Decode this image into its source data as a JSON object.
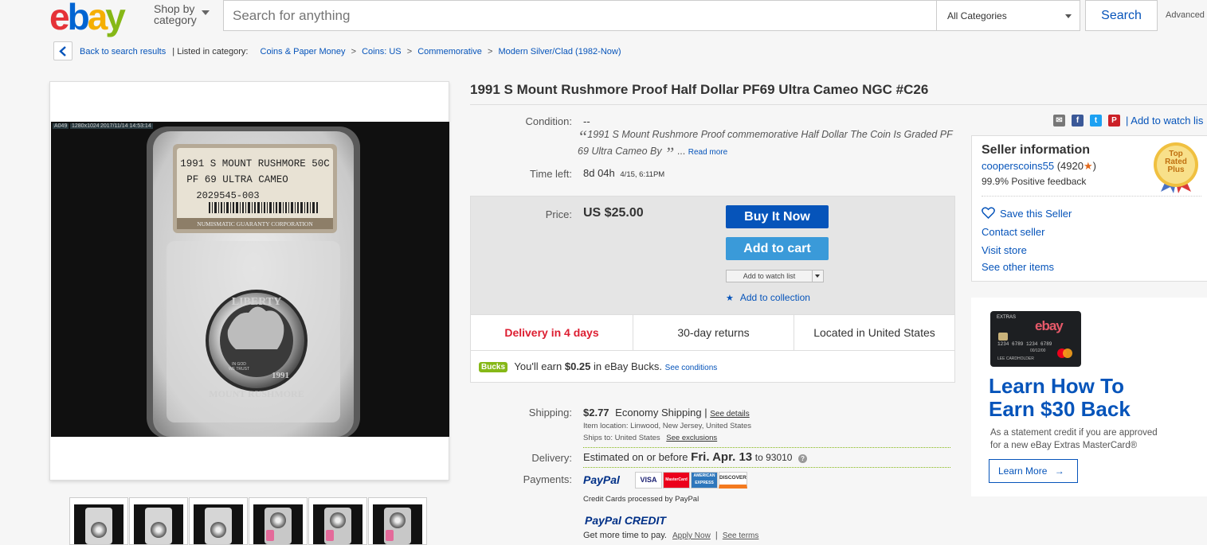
{
  "header": {
    "logo": [
      "e",
      "b",
      "a",
      "y"
    ],
    "shop_by": [
      "Shop by",
      "category"
    ],
    "search_placeholder": "Search for anything",
    "category_select": "All Categories",
    "search_button": "Search",
    "advanced": "Advanced"
  },
  "breadcrumb": {
    "back": "Back to search results",
    "listed_in": "| Listed in category:",
    "items": [
      "Coins & Paper Money",
      "Coins: US",
      "Commemorative",
      "Modern Silver/Clad (1982-Now)"
    ],
    "separator": ">"
  },
  "gallery": {
    "image_tags": [
      "A049",
      "1280x1024",
      "2017/11/14 14:53:14"
    ],
    "thumbnail_count": 6
  },
  "item": {
    "title": "1991 S Mount Rushmore Proof Half Dollar PF69 Ultra Cameo NGC #C26",
    "condition_label": "Condition:",
    "condition_value": "--",
    "condition_desc_open": "“",
    "condition_desc": "1991 S Mount Rushmore Proof commemorative Half Dollar The Coin Is Graded PF 69 Ultra Cameo By",
    "condition_desc_close": "”",
    "ellipsis": "...",
    "read_more": "Read more",
    "time_left_label": "Time left:",
    "time_left_value": "8d 04h",
    "time_left_end": "4/15, 6:11PM"
  },
  "purchase": {
    "price_label": "Price:",
    "price": "US $25.00",
    "buy_now": "Buy It Now",
    "add_to_cart": "Add to cart",
    "add_to_watch": "Add to watch list",
    "add_to_collection": "Add to collection",
    "collection_icon": "star-icon",
    "features": [
      "Delivery in 4 days",
      "30-day returns",
      "Located in United States"
    ],
    "bucks_badge": "Bucks",
    "bucks_text_pre": "You'll earn",
    "bucks_amount": "$0.25",
    "bucks_text_post": "in eBay Bucks.",
    "see_conditions": "See conditions"
  },
  "shipping": {
    "shipping_label": "Shipping:",
    "cost": "$2.77",
    "method": "Economy Shipping",
    "divider": "|",
    "see_details": "See details",
    "item_location": "Item location:  Linwood, New Jersey, United States",
    "ships_to": "Ships to:  United States",
    "see_exclusions": "See exclusions",
    "delivery_label": "Delivery:",
    "delivery_pre": "Estimated on or before",
    "delivery_date": "Fri. Apr. 13",
    "delivery_to": "to 93010",
    "payments_label": "Payments:",
    "paypal": "PayPal",
    "cards": [
      "VISA",
      "MasterCard",
      "AMERICAN EXPRESS",
      "DISCOVER"
    ],
    "cards_note": "Credit Cards processed by PayPal",
    "paypal_credit": "PayPal CREDIT",
    "credit_text": "Get more time to pay.",
    "apply_now": "Apply Now",
    "see_terms": "See terms"
  },
  "share": {
    "icons": [
      "email-icon",
      "facebook-icon",
      "twitter-icon",
      "pinterest-icon"
    ],
    "watch_list": "| Add to watch lis"
  },
  "seller": {
    "heading": "Seller information",
    "name": "cooperscoins55",
    "score": "(4920",
    "score_close": ")",
    "feedback": "99.9% Positive feedback",
    "badge_text": [
      "Top",
      "Rated",
      "Plus"
    ],
    "save": "Save this Seller",
    "contact": "Contact seller",
    "visit": "Visit store",
    "other": "See other items"
  },
  "ad": {
    "card_label": "EXTRAS",
    "card_brand": "ebay",
    "card_number": "1234 6789 1234 6789",
    "card_expiry": "00/12/00",
    "card_holder": "LEE CARDHOLDER",
    "headline_1": "Learn How To",
    "headline_2": "Earn $30 Back",
    "sub_1": "As a statement credit if you are approved",
    "sub_2": "for a new eBay Extras MasterCard®",
    "button": "Learn More"
  },
  "colors": {
    "link": "#0654ba",
    "buy_now": "#0654ba",
    "add_to_cart": "#3a9ad9",
    "delivery_red": "#dd1e31",
    "bucks_green": "#86b817"
  }
}
